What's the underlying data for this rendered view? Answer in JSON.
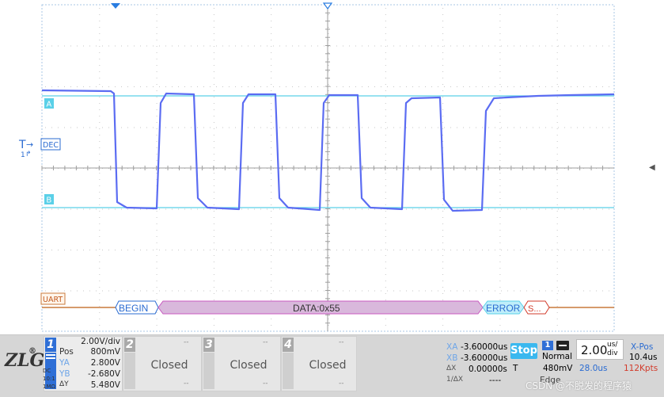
{
  "waveform": {
    "marker_a": "A",
    "marker_b": "B",
    "trigger_label": "DEC",
    "decode_label": "UART",
    "segments": {
      "begin": "BEGIN",
      "data": "DATA:0x55",
      "error": "ERROR",
      "stop": "S..."
    },
    "colors": {
      "signal": "#5b6cf2",
      "cursor_lines": "#5ad0e8",
      "bus_line": "#c87a3c",
      "data_segment": "#d9b8dc",
      "error_segment": "#bfeefa"
    }
  },
  "channel1": {
    "number": "1",
    "scale": "2.00V/div",
    "pos_label": "Pos",
    "pos_value": "800mV",
    "ya_label": "YA",
    "ya_value": "2.800V",
    "yb_label": "YB",
    "yb_value": "-2.680V",
    "dy_label": "ΔY",
    "dy_value": "5.480V",
    "coupling": "DC",
    "probe": "10:1",
    "impedance": "1MΩ"
  },
  "channels": [
    {
      "number": "2",
      "status": "Closed",
      "dash": "--"
    },
    {
      "number": "3",
      "status": "Closed",
      "dash": "--"
    },
    {
      "number": "4",
      "status": "Closed",
      "dash": "--"
    }
  ],
  "measurements": {
    "xa_label": "XA",
    "xa_value": "-3.60000us",
    "xb_label": "XB",
    "xb_value": "-3.60000us",
    "dx_label": "ΔX",
    "dx_value": "0.00000s",
    "inv_dx_label": "1/ΔX",
    "inv_dx_value": "----"
  },
  "run_state": "Stop",
  "trigger": {
    "source": "1",
    "mode": "Normal",
    "level_label": "T",
    "level_value": "480mV",
    "type": "Edge"
  },
  "timebase": {
    "value": "2.00",
    "unit_top": "us/",
    "unit_bottom": "div",
    "delay": "28.0us",
    "xpos_label": "X-Pos",
    "xpos_value": "10.4us",
    "sample_rate": "112Kpts"
  },
  "watermark": "CSDN @不脱发的程序猿"
}
